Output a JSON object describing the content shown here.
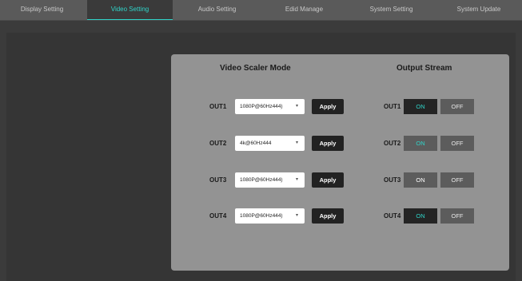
{
  "tabs": [
    "Display Setting",
    "Video Setting",
    "Audio Setting",
    "Edid Manage",
    "System Setting",
    "System Update"
  ],
  "active_tab": "Video Setting",
  "scaler": {
    "heading": "Video Scaler Mode",
    "rows": [
      {
        "label": "OUT1",
        "value": "1080P@60Hz444)",
        "apply": "Apply"
      },
      {
        "label": "OUT2",
        "value": "4k@60Hz444",
        "apply": "Apply"
      },
      {
        "label": "OUT3",
        "value": "1080P@60Hz444)",
        "apply": "Apply"
      },
      {
        "label": "OUT4",
        "value": "1080P@60Hz444)",
        "apply": "Apply"
      }
    ]
  },
  "stream": {
    "heading": "Output Stream",
    "rows": [
      {
        "label": "OUT1",
        "on": "ON",
        "off": "OFF"
      },
      {
        "label": "OUT2",
        "on": "ON",
        "off": "OFF"
      },
      {
        "label": "OUT3",
        "on": "ON",
        "off": "OFF"
      },
      {
        "label": "OUT4",
        "on": "ON",
        "off": "OFF"
      }
    ]
  },
  "colors": {
    "accent": "#2fd4c9",
    "background": "#3b3b3b",
    "card": "#939393",
    "button": "#222222"
  },
  "icons": {
    "dropdown": "chevron-down-icon"
  }
}
